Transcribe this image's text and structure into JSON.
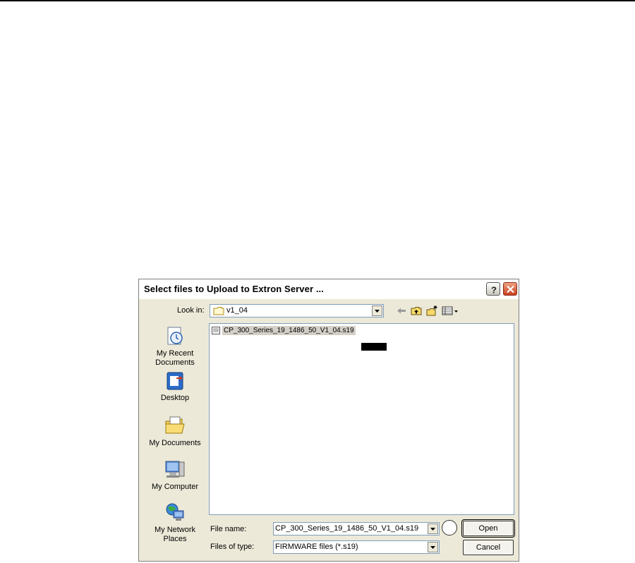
{
  "dialog": {
    "title": "Select files to Upload to Extron Server ...",
    "help_icon": "question-mark-icon",
    "close_icon": "close-x-icon",
    "look_in_label": "Look in:",
    "look_in_value": "v1_04",
    "toolbar_icons": [
      "back-arrow-icon",
      "up-folder-icon",
      "new-folder-icon",
      "view-menu-icon"
    ]
  },
  "places": [
    {
      "label_line1": "My Recent",
      "label_line2": "Documents",
      "icon": "recent-documents-icon"
    },
    {
      "label_line1": "Desktop",
      "label_line2": "",
      "icon": "desktop-icon"
    },
    {
      "label_line1": "My Documents",
      "label_line2": "",
      "icon": "my-documents-icon"
    },
    {
      "label_line1": "My Computer",
      "label_line2": "",
      "icon": "my-computer-icon"
    },
    {
      "label_line1": "My Network",
      "label_line2": "Places",
      "icon": "network-places-icon"
    }
  ],
  "files": [
    {
      "name": "CP_300_Series_19_1486_50_V1_04.s19",
      "icon": "s19-file-icon",
      "selected": true
    }
  ],
  "file_name": {
    "label": "File name:",
    "value": "CP_300_Series_19_1486_50_V1_04.s19"
  },
  "file_type": {
    "label": "Files of type:",
    "value": "FIRMWARE files (*.s19)"
  },
  "buttons": {
    "open": "Open",
    "cancel": "Cancel"
  }
}
